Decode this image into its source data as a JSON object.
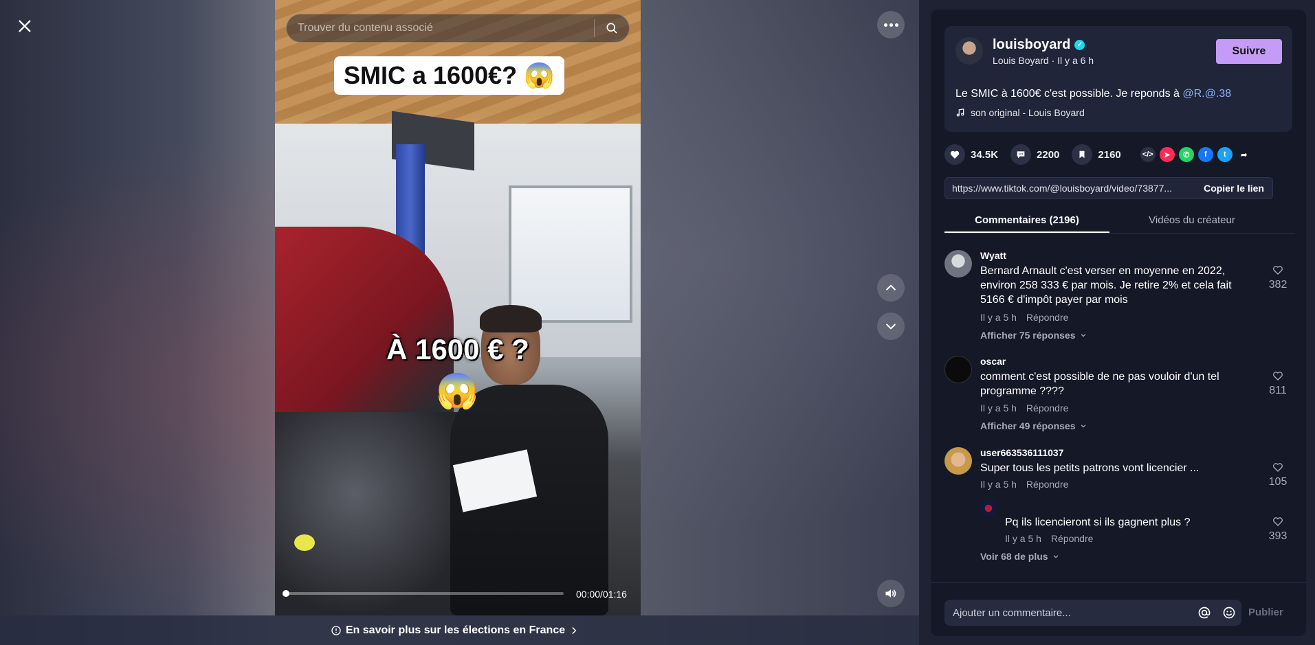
{
  "search": {
    "placeholder": "Trouver du contenu associé"
  },
  "video": {
    "caption_top": "SMIC a 1600€? 😱",
    "caption_mid": "À 1600 € ?",
    "caption_emoji": "😱",
    "time": "00:00/01:16",
    "progress_fraction": 0.0
  },
  "election_banner": {
    "label": "En savoir plus sur les élections en France"
  },
  "post": {
    "username": "louisboyard",
    "display_meta": "Louis Boyard · Il y a 6 h",
    "follow_label": "Suivre",
    "description": "Le SMIC à 1600€ c'est possible. Je reponds à ",
    "mention": "@R.@.38",
    "music": "son original - Louis Boyard"
  },
  "stats": {
    "likes": "34.5K",
    "comments": "2200",
    "saves": "2160"
  },
  "link": {
    "url": "https://www.tiktok.com/@louisboyard/video/73877...",
    "copy_label": "Copier le lien"
  },
  "tabs": [
    {
      "label": "Commentaires (2196)"
    },
    {
      "label": "Vidéos du créateur"
    }
  ],
  "comments": [
    {
      "user": "Wyatt",
      "text": "Bernard Arnault c'est verser en moyenne en 2022, environ 258 333 € par mois. Je retire 2% et cela fait 5166 € d'impôt payer par mois",
      "time": "Il y a 5 h",
      "reply": "Répondre",
      "likes": "382",
      "more": "Afficher 75 réponses"
    },
    {
      "user": "oscar",
      "text": "comment c'est possible de ne pas vouloir d'un tel programme ????",
      "time": "Il y a 5 h",
      "reply": "Répondre",
      "likes": "811",
      "more": "Afficher 49 réponses"
    },
    {
      "user": "user663536111037",
      "text": "Super tous les petits patrons vont licencier ...",
      "time": "Il y a 5 h",
      "reply": "Répondre",
      "likes": "105",
      "more": ""
    }
  ],
  "reply": {
    "text": "Pq ils licencieront si ils gagnent plus ?",
    "time": "Il y a 5 h",
    "reply": "Répondre",
    "likes": "393",
    "more": "Voir 68 de plus"
  },
  "composer": {
    "placeholder": "Ajouter un commentaire...",
    "publish_label": "Publier"
  },
  "colors": {
    "accent_follow": "#c49cf7",
    "panel_bg": "#151827",
    "mention": "#8fb4ff"
  },
  "icons": [
    "close-icon",
    "more-icon",
    "search-icon",
    "chevron-up-icon",
    "chevron-down-icon",
    "volume-icon",
    "info-icon",
    "chevron-right-icon",
    "verified-icon",
    "music-note-icon",
    "heart-icon",
    "comment-icon",
    "bookmark-icon",
    "embed-icon",
    "send-icon",
    "whatsapp-icon",
    "facebook-icon",
    "twitter-icon",
    "share-icon",
    "at-icon",
    "emoji-icon"
  ]
}
